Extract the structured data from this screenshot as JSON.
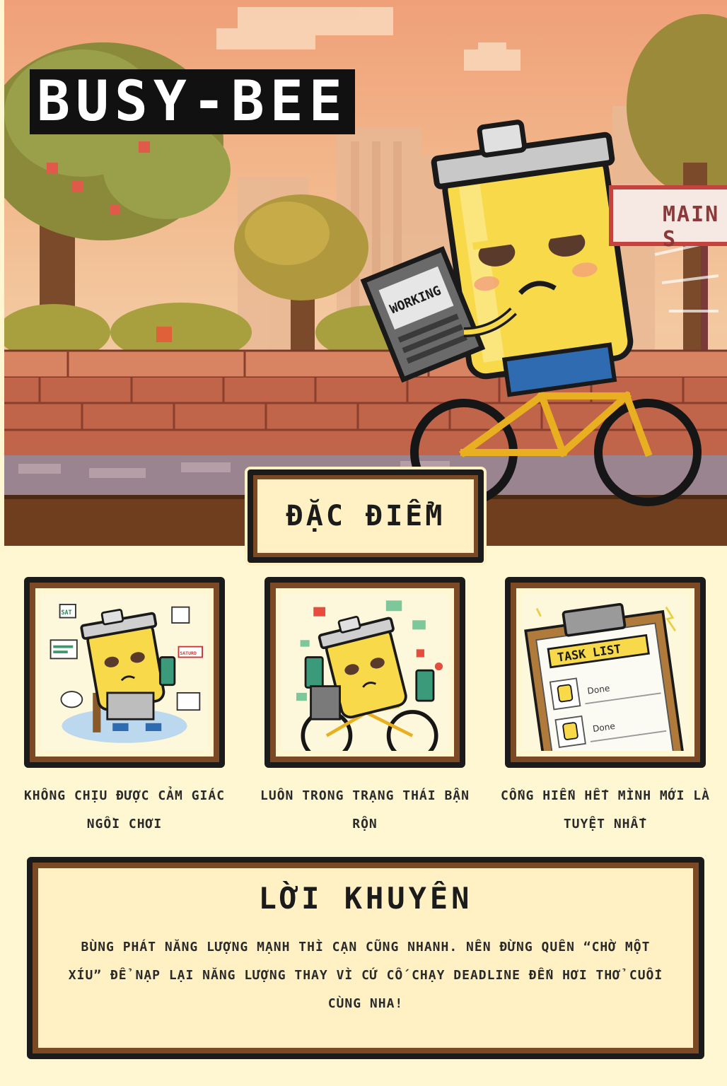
{
  "hero": {
    "title": "BUSY-BEE",
    "sign_text": "MAIN S",
    "laptop_text": "WORKING",
    "colors": {
      "sky": "#f0a078",
      "brick": "#b8583a",
      "can": "#f7d94a",
      "bike": "#1a1a1a"
    }
  },
  "section": {
    "title": "ĐẶC ĐIỂM"
  },
  "cards": [
    {
      "icon": "can-character-laptop-icon",
      "caption": "KHÔNG CHỊU ĐƯỢC CẢM GIÁC NGỒI CHƠI",
      "labels": [
        "SAT",
        "SATURD"
      ]
    },
    {
      "icon": "can-character-bike-phones-icon",
      "caption": "LUÔN TRONG TRẠNG THÁI BẬN RỘN",
      "labels": []
    },
    {
      "icon": "task-list-clipboard-icon",
      "caption": "CỐNG HIẾN HẾT MÌNH MỚI LÀ TUYỆT NHẤT",
      "labels": [
        "TASK LIST",
        "Done",
        "Done"
      ]
    }
  ],
  "advice": {
    "title": "LỜI KHUYÊN",
    "text": "BÙNG PHÁT NĂNG LƯỢNG MẠNH THÌ CẠN CŨNG NHANH. NÊN ĐỪNG QUÊN “CHỜ MỘT XÍU” ĐỂ NẠP LẠI NĂNG LƯỢNG THAY VÌ CỨ CỐ CHẠY DEADLINE ĐẾN HƠI THỞ CUỐI CÙNG NHA!"
  }
}
